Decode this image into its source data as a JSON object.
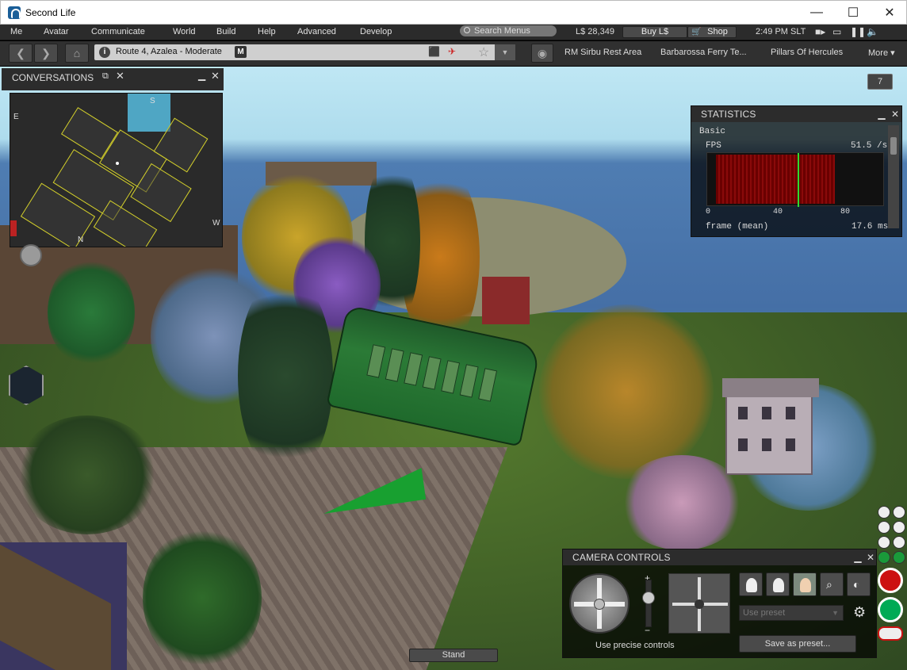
{
  "window": {
    "title": "Second Life",
    "minimize": "—",
    "maximize": "☐",
    "close": "✕"
  },
  "menubar": {
    "items": [
      "Me",
      "Avatar",
      "Communicate",
      "World",
      "Build",
      "Help",
      "Advanced",
      "Develop"
    ],
    "search_placeholder": "Search Menus",
    "balance": "L$ 28,349",
    "buy_label": "Buy L$",
    "shop_label": "Shop",
    "clock": "2:49 PM SLT"
  },
  "navbar": {
    "location": "Route 4, Azalea - Moderate",
    "maturity": "M",
    "favorites": [
      "RM Sirbu Rest Area",
      "Barbarossa Ferry Te...",
      "Pillars Of Hercules"
    ],
    "more_label": "More ▾"
  },
  "conversations": {
    "title": "CONVERSATIONS"
  },
  "minimap": {
    "labels": {
      "north": "N",
      "south": "S",
      "east": "E",
      "west": "W"
    }
  },
  "notifications": {
    "count": "7"
  },
  "statistics": {
    "title": "STATISTICS",
    "section": "Basic",
    "fps_label": "FPS",
    "fps_value": "51.5 /s",
    "fps_value_num": 51.5,
    "axis_ticks": [
      "0",
      "40",
      "80"
    ],
    "frame_label": "frame (mean)",
    "frame_value": "17.6 ms"
  },
  "camera_controls": {
    "title": "CAMERA CONTROLS",
    "precise_label": "Use precise controls",
    "preset_placeholder": "Use preset",
    "save_preset_label": "Save as preset..."
  },
  "stand_label": "Stand"
}
